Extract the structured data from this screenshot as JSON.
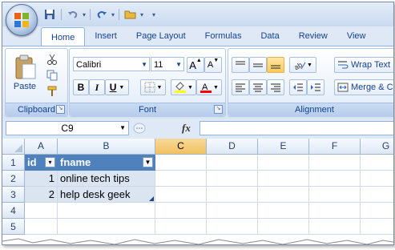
{
  "ribbon_tabs": [
    "Home",
    "Insert",
    "Page Layout",
    "Formulas",
    "Data",
    "Review",
    "View"
  ],
  "clipboard": {
    "paste_label": "Paste",
    "group_label": "Clipboard"
  },
  "font": {
    "name": "Calibri",
    "size": "11",
    "group_label": "Font",
    "bold": "B",
    "italic": "I",
    "underline": "U",
    "grow": "A",
    "shrink": "A"
  },
  "alignment": {
    "group_label": "Alignment",
    "wrap_text": "Wrap Text",
    "merge_center": "Merge & C"
  },
  "formula_bar": {
    "name_box": "C9",
    "fx": "fx",
    "formula": ""
  },
  "sheet": {
    "columns": [
      "A",
      "B",
      "C",
      "D",
      "E",
      "F",
      "G"
    ],
    "selected_column": "C",
    "rows": [
      "1",
      "2",
      "3",
      "4",
      "5"
    ],
    "cells": {
      "A1": "id",
      "B1": "fname",
      "A2": "1",
      "B2": "online tech tips",
      "A3": "2",
      "B3": "help desk geek"
    }
  },
  "colors": {
    "table_header": "#4f81bd",
    "table_band": "#dbe5f1",
    "selected_header": "#f1c15f",
    "font_color_bar": "#ff0000",
    "fill_color_bar": "#ffff00"
  }
}
